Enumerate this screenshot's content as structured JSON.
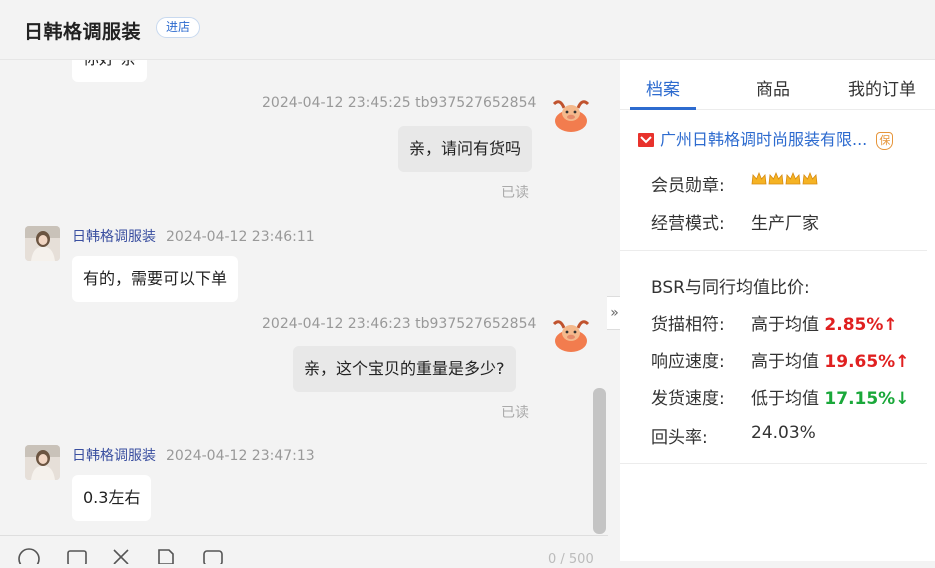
{
  "header": {
    "shop_name": "日韩格调服装",
    "enter_shop": "进店"
  },
  "chat": {
    "partial_top_message": "你好 亲",
    "messages": [
      {
        "meta": "2024-04-12 23:45:25   tb937527652854",
        "text": "亲，请问有货吗",
        "status": "已读"
      },
      {
        "sender": "日韩格调服装",
        "time": "2024-04-12 23:46:11",
        "text": "有的，需要可以下单"
      },
      {
        "meta": "2024-04-12 23:46:23   tb937527652854",
        "text": "亲，这个宝贝的重量是多少?",
        "status": "已读"
      },
      {
        "sender": "日韩格调服装",
        "time": "2024-04-12 23:47:13",
        "text": "0.3左右"
      }
    ],
    "collapse_icon": "»",
    "char_counter": "0 / 500"
  },
  "panel": {
    "tabs": [
      "档案",
      "商品",
      "我的订单"
    ],
    "company": "广州日韩格调时尚服装有限...",
    "company_badge": "保",
    "member_badge_label": "会员勋章:",
    "business_mode_label": "经营模式:",
    "business_mode_value": "生产厂家",
    "bsr_title": "BSR与同行均值比价:",
    "metrics": [
      {
        "label": "货描相符:",
        "text": "高于均值",
        "value": "2.85%",
        "arrow": "↑"
      },
      {
        "label": "响应速度:",
        "text": "高于均值",
        "value": "19.65%",
        "arrow": "↑"
      },
      {
        "label": "发货速度:",
        "text": "低于均值",
        "value": "17.15%",
        "arrow": "↓"
      }
    ],
    "repeat_label": "回头率:",
    "repeat_value": "24.03%"
  },
  "colors": {
    "accent": "#2d6bcf",
    "up": "#e02020",
    "down": "#1aa83a"
  }
}
